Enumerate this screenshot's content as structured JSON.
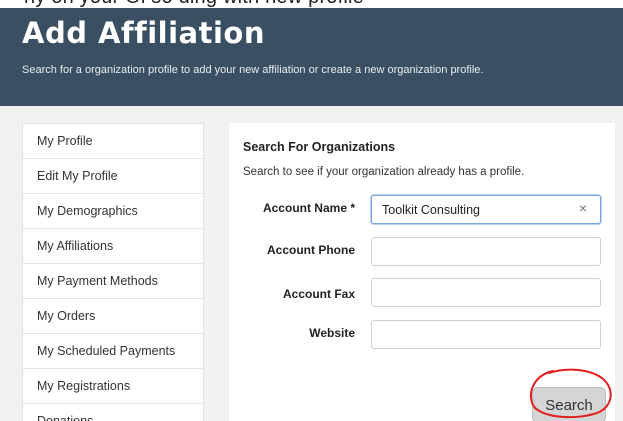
{
  "top_fragment": "ny on your Oi so ding with new profile",
  "header": {
    "title": "Add Affiliation",
    "subtitle": "Search for a organization profile to add your new affiliation or create a new organization profile."
  },
  "sidebar": {
    "items": [
      {
        "label": "My Profile"
      },
      {
        "label": "Edit My Profile"
      },
      {
        "label": "My Demographics"
      },
      {
        "label": "My Affiliations"
      },
      {
        "label": "My Payment Methods"
      },
      {
        "label": "My Orders"
      },
      {
        "label": "My Scheduled Payments"
      },
      {
        "label": "My Registrations"
      },
      {
        "label": "Donations"
      }
    ]
  },
  "search_form": {
    "title": "Search For Organizations",
    "description": "Search to see if your organization already has a profile.",
    "account_name": {
      "label": "Account Name *",
      "value": "Toolkit Consulting"
    },
    "account_phone": {
      "label": "Account Phone",
      "value": ""
    },
    "account_fax": {
      "label": "Account Fax",
      "value": ""
    },
    "website": {
      "label": "Website",
      "value": ""
    },
    "search_label": "Search",
    "clear_glyph": "×"
  },
  "colors": {
    "header_bg": "#3a4f61",
    "annotation": "#e02020",
    "button_bg": "#d5d5d5"
  }
}
